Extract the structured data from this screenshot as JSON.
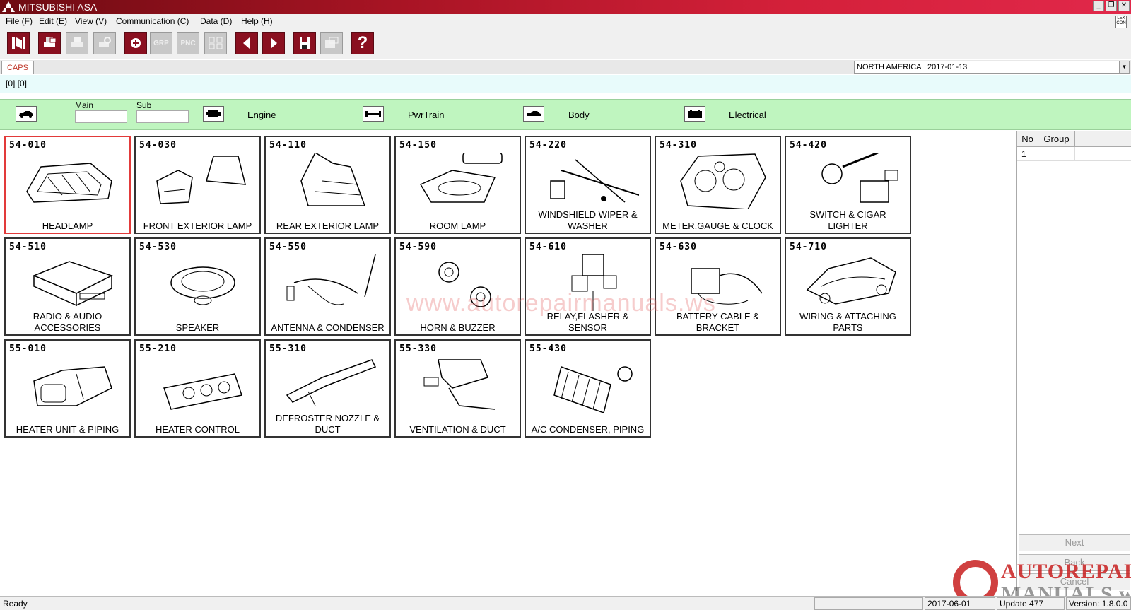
{
  "window": {
    "title": "MITSUBISHI ASA",
    "controls": [
      "_",
      "❐",
      "✕"
    ]
  },
  "menu": [
    "File (F)",
    "Edit (E)",
    "View (V)",
    "Communication (C)",
    "Data (D)",
    "Help (H)"
  ],
  "lexcon": "LEX\nCON",
  "toolbar": {
    "grp_label": "GRP",
    "pnc_label": "PNC",
    "help_label": "?"
  },
  "tab": {
    "caps_label": "CAPS"
  },
  "region": {
    "value": "NORTH AMERICA   2017-01-13"
  },
  "info_text": "[0] [0]",
  "categories": {
    "main_label": "Main",
    "sub_label": "Sub",
    "engine": "Engine",
    "pwrtrain": "PwrTrain",
    "body": "Body",
    "electrical": "Electrical"
  },
  "tiles": [
    {
      "code": "54-010",
      "label": "HEADLAMP"
    },
    {
      "code": "54-030",
      "label": "FRONT EXTERIOR LAMP"
    },
    {
      "code": "54-110",
      "label": "REAR EXTERIOR LAMP"
    },
    {
      "code": "54-150",
      "label": "ROOM LAMP"
    },
    {
      "code": "54-220",
      "label": "WINDSHIELD WIPER & WASHER"
    },
    {
      "code": "54-310",
      "label": "METER,GAUGE & CLOCK"
    },
    {
      "code": "54-420",
      "label": "SWITCH & CIGAR LIGHTER"
    },
    {
      "code": "54-510",
      "label": "RADIO & AUDIO ACCESSORIES"
    },
    {
      "code": "54-530",
      "label": "SPEAKER"
    },
    {
      "code": "54-550",
      "label": "ANTENNA & CONDENSER"
    },
    {
      "code": "54-590",
      "label": "HORN & BUZZER"
    },
    {
      "code": "54-610",
      "label": "RELAY,FLASHER & SENSOR"
    },
    {
      "code": "54-630",
      "label": "BATTERY CABLE & BRACKET"
    },
    {
      "code": "54-710",
      "label": "WIRING & ATTACHING PARTS"
    },
    {
      "code": "55-010",
      "label": "HEATER UNIT & PIPING"
    },
    {
      "code": "55-210",
      "label": "HEATER CONTROL"
    },
    {
      "code": "55-310",
      "label": "DEFROSTER NOZZLE & DUCT"
    },
    {
      "code": "55-330",
      "label": "VENTILATION & DUCT"
    },
    {
      "code": "55-430",
      "label": "A/C CONDENSER, PIPING"
    }
  ],
  "right_panel": {
    "col_no": "No",
    "col_group": "Group",
    "row_no": "1",
    "next_label": "Next",
    "back_label": "Back",
    "cancel_label": "Cancel"
  },
  "watermark": {
    "url": "www.autorepairmanuals.ws",
    "brand_line1": "AUTOREPAIR",
    "brand_line2": "MANUALS.ws"
  },
  "status": {
    "text": "Ready",
    "date": "2017-06-01",
    "update": "Update 477",
    "version": "Version: 1.8.0.0"
  }
}
